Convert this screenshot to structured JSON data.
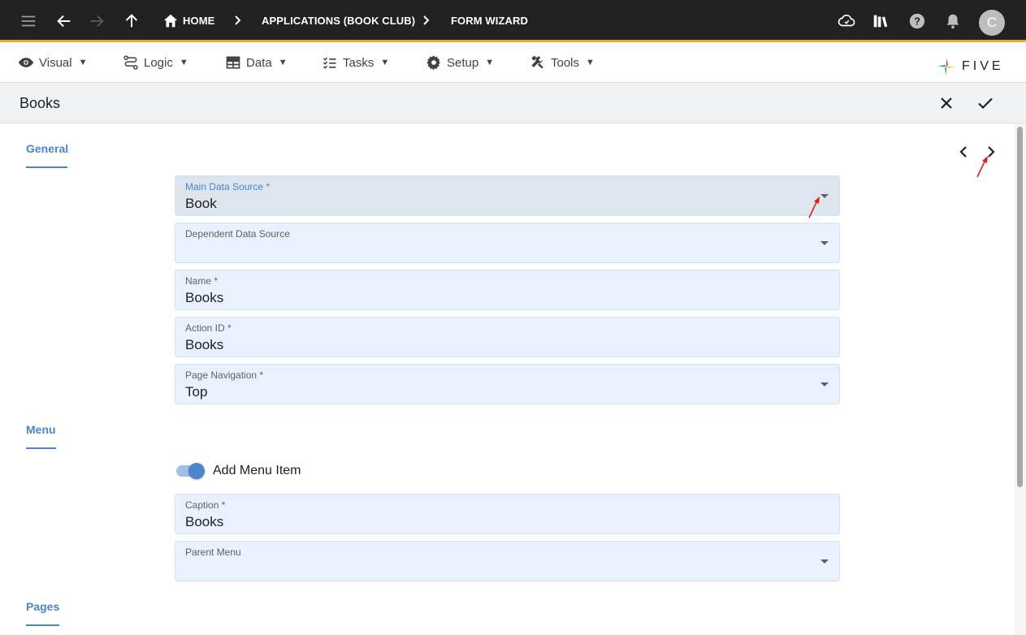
{
  "topbar": {
    "breadcrumbs": [
      "HOME",
      "APPLICATIONS (BOOK CLUB)",
      "FORM WIZARD"
    ],
    "avatar_initial": "C"
  },
  "menubar": {
    "items": [
      {
        "label": "Visual",
        "icon": "eye-icon"
      },
      {
        "label": "Logic",
        "icon": "logic-icon"
      },
      {
        "label": "Data",
        "icon": "table-icon"
      },
      {
        "label": "Tasks",
        "icon": "checklist-icon"
      },
      {
        "label": "Setup",
        "icon": "gear-icon"
      },
      {
        "label": "Tools",
        "icon": "tools-icon"
      }
    ],
    "caret": "▼",
    "logo_text": "FIVE"
  },
  "titlebar": {
    "title": "Books"
  },
  "sections": {
    "general": "General",
    "menu": "Menu",
    "pages": "Pages"
  },
  "fields": {
    "main_data_source": {
      "label": "Main Data Source *",
      "value": "Book"
    },
    "dependent_data_source": {
      "label": "Dependent Data Source",
      "value": ""
    },
    "name": {
      "label": "Name *",
      "value": "Books"
    },
    "action_id": {
      "label": "Action ID *",
      "value": "Books"
    },
    "page_navigation": {
      "label": "Page Navigation *",
      "value": "Top"
    },
    "caption": {
      "label": "Caption *",
      "value": "Books"
    },
    "parent_menu": {
      "label": "Parent Menu",
      "value": ""
    }
  },
  "toggle": {
    "label": "Add Menu Item",
    "checked": true
  },
  "colors": {
    "accent": "#4a86c8",
    "topbar_bg": "#212121",
    "topbar_border": "#f5a623",
    "field_bg": "#e8f1fd",
    "annotation_arrow": "#e02020"
  }
}
